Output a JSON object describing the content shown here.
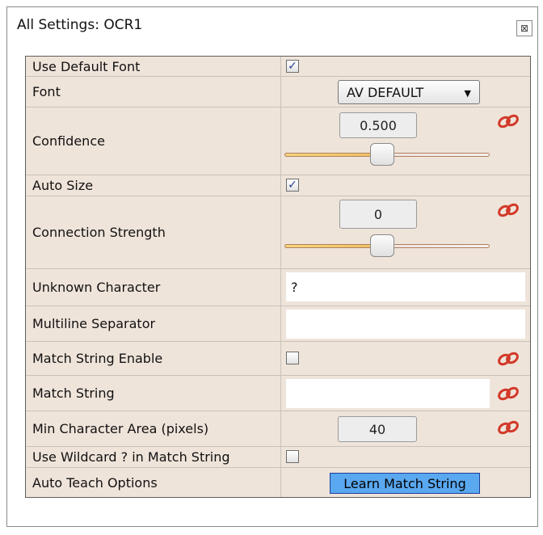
{
  "window": {
    "title": "All Settings: OCR1",
    "close_glyph": "⊠"
  },
  "rows": [
    {
      "label": "Use Default Font",
      "control": "checkbox",
      "checked": true
    },
    {
      "label": "Font",
      "control": "dropdown",
      "value": "AV DEFAULT"
    },
    {
      "label": "Confidence",
      "control": "number-slider",
      "value": "0.500",
      "slider_fraction": 0.5,
      "linked": true
    },
    {
      "label": "Auto Size",
      "control": "checkbox",
      "checked": true
    },
    {
      "label": "Connection Strength",
      "control": "number-slider",
      "value": "0",
      "slider_fraction": 0.5,
      "linked": true
    },
    {
      "label": "Unknown Character",
      "control": "text",
      "value": "?"
    },
    {
      "label": "Multiline Separator",
      "control": "text",
      "value": ""
    },
    {
      "label": "Match String Enable",
      "control": "checkbox",
      "checked": false,
      "linked": true
    },
    {
      "label": "Match String",
      "control": "text",
      "value": "",
      "linked": true
    },
    {
      "label": "Min Character Area (pixels)",
      "control": "number",
      "value": "40",
      "linked": true
    },
    {
      "label": "Use Wildcard ? in Match String",
      "control": "checkbox",
      "checked": false
    },
    {
      "label": "Auto Teach Options",
      "control": "button",
      "value": "Learn Match String"
    }
  ],
  "glyphs": {
    "check": "✓",
    "dropdown_arrow": "▼"
  },
  "colors": {
    "grid_bg": "#efe4da",
    "link_icon": "#d23a2a",
    "button_bg": "#5aa8f0"
  }
}
